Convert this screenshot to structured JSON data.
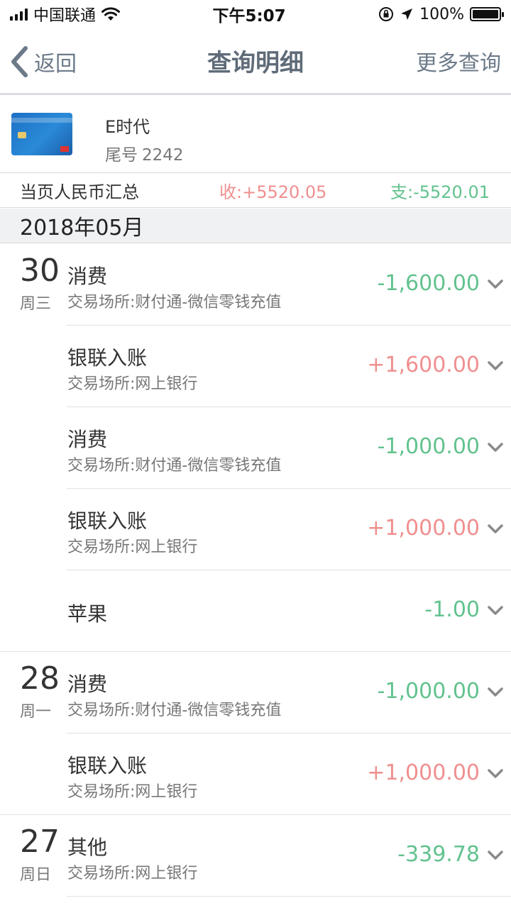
{
  "status_bar": {
    "carrier": "中国联通",
    "time": "下午5:07",
    "battery": "100%",
    "battery_level": 1.0
  },
  "nav": {
    "back_label": "返回",
    "title": "查询明细",
    "more_label": "更多查询"
  },
  "account": {
    "name": "E时代",
    "tail_label": "尾号",
    "tail_number": "2242"
  },
  "summary": {
    "label": "当页人民币汇总",
    "income": "收:+5520.05",
    "expense": "支:-5520.01"
  },
  "month": "2018年05月",
  "transactions": [
    {
      "day": "30",
      "weekday": "周三",
      "type": "消费",
      "place": "交易场所:财付通-微信零钱充值",
      "amount": "-1,600.00",
      "sign": "neg"
    },
    {
      "day": "",
      "weekday": "",
      "type": "银联入账",
      "place": "交易场所:网上银行",
      "amount": "+1,600.00",
      "sign": "pos"
    },
    {
      "day": "",
      "weekday": "",
      "type": "消费",
      "place": "交易场所:财付通-微信零钱充值",
      "amount": "-1,000.00",
      "sign": "neg"
    },
    {
      "day": "",
      "weekday": "",
      "type": "银联入账",
      "place": "交易场所:网上银行",
      "amount": "+1,000.00",
      "sign": "pos"
    },
    {
      "day": "",
      "weekday": "",
      "type": "苹果",
      "place": "",
      "amount": "-1.00",
      "sign": "neg"
    },
    {
      "day": "28",
      "weekday": "周一",
      "type": "消费",
      "place": "交易场所:财付通-微信零钱充值",
      "amount": "-1,000.00",
      "sign": "neg"
    },
    {
      "day": "",
      "weekday": "",
      "type": "银联入账",
      "place": "交易场所:网上银行",
      "amount": "+1,000.00",
      "sign": "pos"
    },
    {
      "day": "27",
      "weekday": "周日",
      "type": "其他",
      "place": "交易场所:网上银行",
      "amount": "-339.78",
      "sign": "neg"
    }
  ],
  "colors": {
    "income": "#f08f8f",
    "expense": "#62c28e",
    "nav_text": "#6c7a89"
  }
}
